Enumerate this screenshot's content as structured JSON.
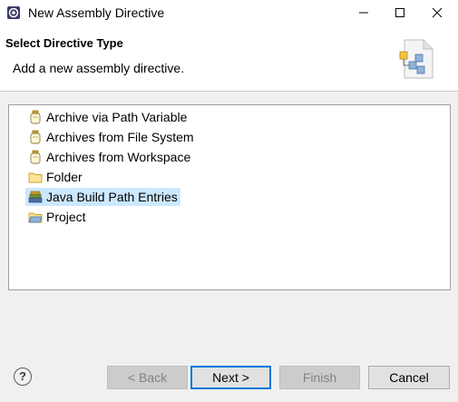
{
  "window": {
    "title": "New Assembly Directive",
    "icons": [
      "eclipse-app-icon",
      "minimize-icon",
      "maximize-icon",
      "close-icon"
    ]
  },
  "header": {
    "title": "Select Directive Type",
    "description": "Add a new assembly directive."
  },
  "tree": {
    "items": [
      {
        "label": "Archive via Path Variable",
        "icon": "jar-icon"
      },
      {
        "label": "Archives from File System",
        "icon": "jar-icon"
      },
      {
        "label": "Archives from Workspace",
        "icon": "jar-icon"
      },
      {
        "label": "Folder",
        "icon": "folder-icon"
      },
      {
        "label": "Java Build Path Entries",
        "icon": "library-icon",
        "selected": true
      },
      {
        "label": "Project",
        "icon": "project-icon"
      }
    ]
  },
  "buttons": {
    "help": "?",
    "back": "< Back",
    "next": "Next >",
    "finish": "Finish",
    "cancel": "Cancel"
  },
  "colors": {
    "selection": "#cce8ff",
    "default_button_border": "#0078d7"
  }
}
